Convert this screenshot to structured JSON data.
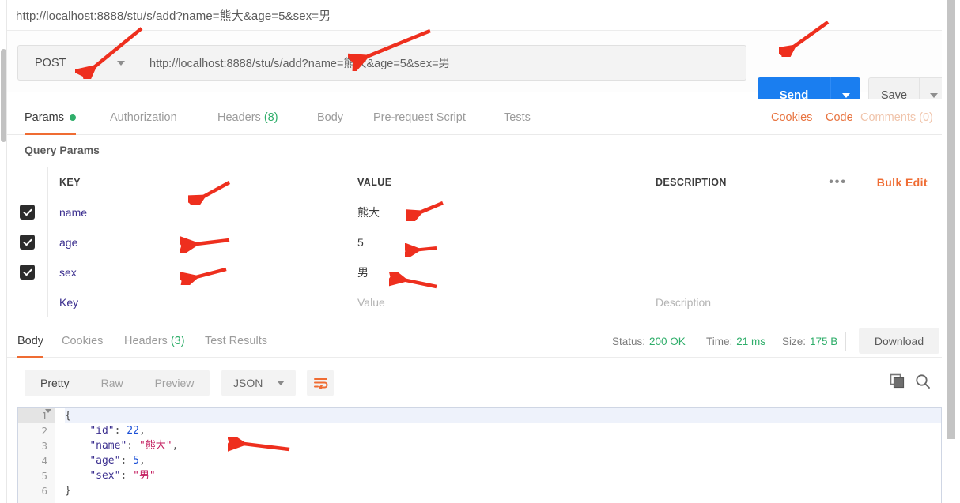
{
  "top_url": "http://localhost:8888/stu/s/add?name=熊大&age=5&sex=男",
  "request": {
    "method": "POST",
    "url": "http://localhost:8888/stu/s/add?name=熊大&age=5&sex=男",
    "send_label": "Send",
    "save_label": "Save"
  },
  "request_tabs": [
    {
      "label": "Params",
      "badge": "",
      "dot": true,
      "active": true
    },
    {
      "label": "Authorization",
      "badge": "",
      "dot": false,
      "active": false
    },
    {
      "label": "Headers",
      "badge": "(8)",
      "dot": false,
      "active": false
    },
    {
      "label": "Body",
      "badge": "",
      "dot": false,
      "active": false
    },
    {
      "label": "Pre-request Script",
      "badge": "",
      "dot": false,
      "active": false
    },
    {
      "label": "Tests",
      "badge": "",
      "dot": false,
      "active": false
    }
  ],
  "request_links": [
    {
      "label": "Cookies",
      "muted": false
    },
    {
      "label": "Code",
      "muted": false
    },
    {
      "label": "Comments (0)",
      "muted": true
    }
  ],
  "query_params": {
    "section_title": "Query Params",
    "columns": [
      "KEY",
      "VALUE",
      "DESCRIPTION"
    ],
    "menu_dots": "•••",
    "bulk_edit_label": "Bulk Edit",
    "rows": [
      {
        "checked": true,
        "key": "name",
        "value": "熊大",
        "description": ""
      },
      {
        "checked": true,
        "key": "age",
        "value": "5",
        "description": ""
      },
      {
        "checked": true,
        "key": "sex",
        "value": "男",
        "description": ""
      }
    ],
    "empty_row": {
      "key_placeholder": "Key",
      "value_placeholder": "Value",
      "desc_placeholder": "Description"
    }
  },
  "response_tabs": [
    {
      "label": "Body",
      "badge": "",
      "active": true
    },
    {
      "label": "Cookies",
      "badge": "",
      "active": false
    },
    {
      "label": "Headers",
      "badge": "(3)",
      "active": false
    },
    {
      "label": "Test Results",
      "badge": "",
      "active": false
    }
  ],
  "response_meta": {
    "status_label": "Status:",
    "status_value": "200 OK",
    "time_label": "Time:",
    "time_value": "21 ms",
    "size_label": "Size:",
    "size_value": "175 B",
    "download_label": "Download"
  },
  "body_toolbar": {
    "views": [
      {
        "label": "Pretty",
        "active": true
      },
      {
        "label": "Raw",
        "active": false
      },
      {
        "label": "Preview",
        "active": false
      }
    ],
    "format": "JSON"
  },
  "response_body": {
    "line_numbers": [
      "1",
      "2",
      "3",
      "4",
      "5",
      "6"
    ],
    "lines": [
      {
        "indent": 0,
        "open": "{"
      },
      {
        "indent": 1,
        "key": "\"id\"",
        "sep": ": ",
        "value": "22",
        "type": "num",
        "comma": ","
      },
      {
        "indent": 1,
        "key": "\"name\"",
        "sep": ": ",
        "value": "\"熊大\"",
        "type": "str",
        "comma": ","
      },
      {
        "indent": 1,
        "key": "\"age\"",
        "sep": ": ",
        "value": "5",
        "type": "num",
        "comma": ","
      },
      {
        "indent": 1,
        "key": "\"sex\"",
        "sep": ": ",
        "value": "\"男\"",
        "type": "str",
        "comma": ""
      },
      {
        "indent": 0,
        "close": "}"
      }
    ]
  },
  "colors": {
    "accent_orange": "#ef6c33",
    "send_blue": "#1a7ef0",
    "status_green": "#2fae6a",
    "arrow_red": "#ee2f1e"
  },
  "annotations": [
    {
      "name": "arrow-method",
      "points_to": "method-selector"
    },
    {
      "name": "arrow-url",
      "points_to": "url-input"
    },
    {
      "name": "arrow-send",
      "points_to": "send-button"
    },
    {
      "name": "arrow-key-column",
      "points_to": "key-column"
    },
    {
      "name": "arrow-value-name",
      "points_to": "value-name"
    },
    {
      "name": "arrow-key-age",
      "points_to": "key-age"
    },
    {
      "name": "arrow-value-age",
      "points_to": "value-age"
    },
    {
      "name": "arrow-key-sex",
      "points_to": "key-sex"
    },
    {
      "name": "arrow-value-sex",
      "points_to": "value-sex"
    },
    {
      "name": "arrow-response-body",
      "points_to": "json-body"
    }
  ]
}
